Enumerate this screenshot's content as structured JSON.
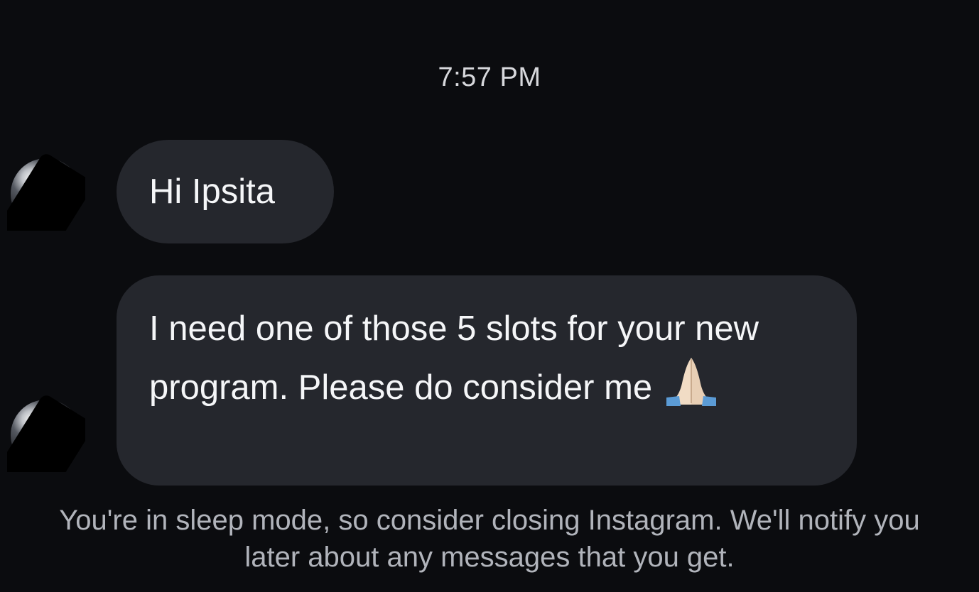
{
  "conversation": {
    "timestamp": "7:57 PM",
    "messages": [
      {
        "text": "Hi Ipsita"
      },
      {
        "text": "I need one of those 5 slots for your new program. Please do consider me",
        "emoji": "folded-hands"
      }
    ]
  },
  "notice": {
    "text": "You're in sleep mode, so consider closing Instagram. We'll notify you later about any messages that you get."
  },
  "colors": {
    "background": "#0b0c0f",
    "bubble": "#25272d",
    "text": "#f5f6f8",
    "muted_text": "#b1b4bb"
  }
}
